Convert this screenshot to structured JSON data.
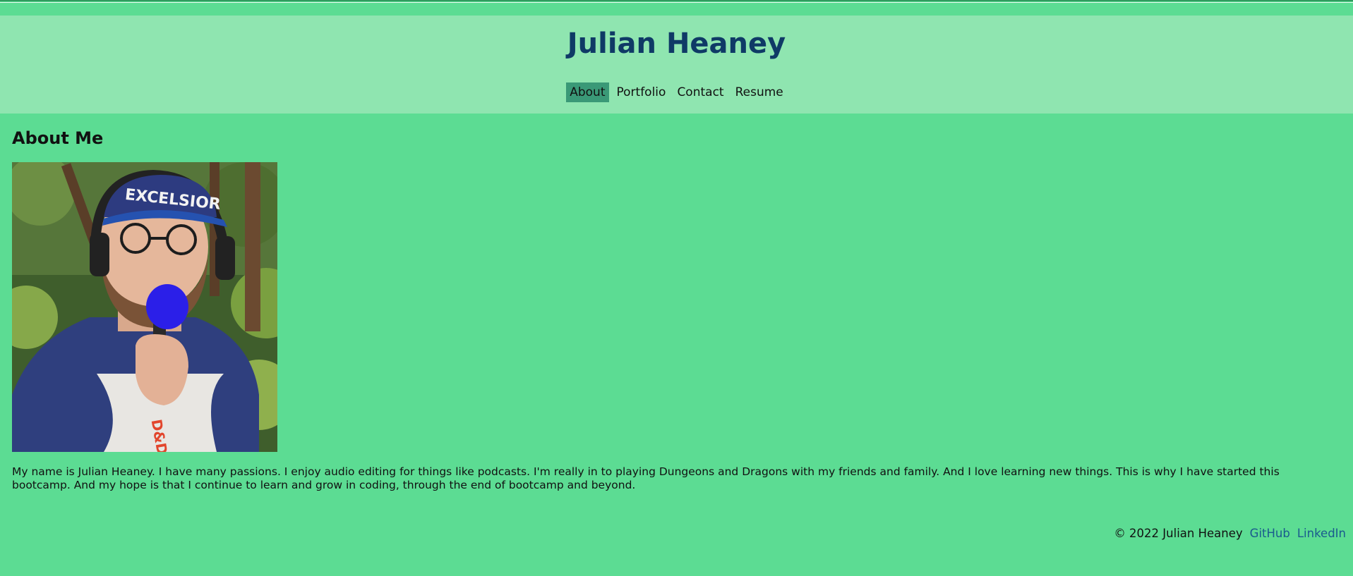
{
  "header": {
    "title": "Julian Heaney",
    "nav": [
      {
        "label": "About",
        "active": true
      },
      {
        "label": "Portfolio",
        "active": false
      },
      {
        "label": "Contact",
        "active": false
      },
      {
        "label": "Resume",
        "active": false
      }
    ]
  },
  "main": {
    "section_title": "About Me",
    "photo": {
      "cap_text": "EXCELSIOR",
      "shirt_text": "D&D"
    },
    "bio": "My name is Julian Heaney. I have many passions. I enjoy audio editing for things like podcasts. I'm really in to playing Dungeons and Dragons with my friends and family. And I love learning new things. This is why I have started this bootcamp. And my hope is that I continue to learn and grow in coding, through the end of bootcamp and beyond."
  },
  "footer": {
    "copyright": "© 2022 Julian Heaney",
    "links": [
      "GitHub",
      "LinkedIn"
    ]
  },
  "colors": {
    "page_bg": "#5cdc93",
    "header_bg": "#8fe5b0",
    "title": "#0f3a66",
    "nav_active": "#3a9977",
    "link": "#1a5a8e"
  }
}
